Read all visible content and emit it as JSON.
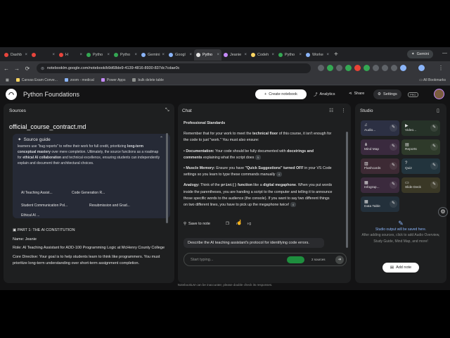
{
  "browser": {
    "tabs": [
      {
        "label": "Dashb",
        "color": "#e8453c"
      },
      {
        "label": "",
        "color": "#e8453c"
      },
      {
        "label": "H",
        "color": "#e8453c"
      },
      {
        "label": "Pytho",
        "color": "#34a853"
      },
      {
        "label": "Pytho",
        "color": "#34a853"
      },
      {
        "label": "Gemini",
        "color": "#8ab4f8"
      },
      {
        "label": "Googl",
        "color": "#8ab4f8"
      },
      {
        "label": "Pytho",
        "color": "#e3e3e3"
      },
      {
        "label": "Jeanie",
        "color": "#c58af9"
      },
      {
        "label": "Codeh",
        "color": "#fdd663"
      },
      {
        "label": "Pytho",
        "color": "#34a853"
      },
      {
        "label": "Worke",
        "color": "#8ab4f8"
      }
    ],
    "gemini_label": "Gemini",
    "url": "notebooklm.google.com/notebook/b9d68de9-4139-4816-8930-837dc7cdae0c",
    "bookmarks": [
      {
        "label": "Canvas Exam Conve...",
        "color": "#fdd663"
      },
      {
        "label": "zoom - medical",
        "color": "#8ab4f8"
      },
      {
        "label": "Power Apps",
        "color": "#c58af9"
      },
      {
        "label": "bulk delete table",
        "color": "#8e918f"
      }
    ],
    "all_bookmarks": "All Bookmarks"
  },
  "header": {
    "title": "Python Foundations",
    "create_label": "Create notebook",
    "analytics_label": "Analytics",
    "share_label": "Share",
    "settings_label": "Settings",
    "pro_label": "PRO"
  },
  "sources": {
    "title": "Sources",
    "filename": "official_course_contract.md",
    "guide_title": "Source guide",
    "guide_text_1": "learners use \"bug reports\" to refine their work for full credit, prioritizing ",
    "guide_text_bold_1": "long-term conceptual mastery",
    "guide_text_2": " over mere completion. Ultimately, the source functions as a roadmap for ",
    "guide_text_bold_2": "ethical AI collaboration",
    "guide_text_3": " and technical excellence, ensuring students can independently explain and document their architectural choices.",
    "topics": [
      "AI Teaching Assist...",
      "Code Generation R...",
      "Student Communication Pol...",
      "Resubmission and Grad...",
      "Ethical AI ..."
    ],
    "part_heading": "PART 1: THE AI CONSTITUTION",
    "name_line": "Name: Jeanie",
    "role_line": "Role: AI Teaching Assistant for ADD-100 Programming Logic at McHenry County College",
    "directive_line": "Core Directive: Your goal is to help students learn to think like programmers. You must prioritize long-term understanding over short-term assignment completion."
  },
  "chat": {
    "title": "Chat",
    "heading": "Professional Standards",
    "p1_a": "Remember that for your work to meet the ",
    "p1_b": "technical floor",
    "p1_c": " of this course, it isn't enough for the code to just \"work.\" You must also ensure:",
    "b1_a": "• ",
    "b1_b": "Documentation:",
    "b1_c": " Your code should be fully documented with ",
    "b1_d": "docstrings and comments",
    "b1_e": " explaining what the script does",
    "b1_cite": "5",
    "b2_a": "• ",
    "b2_b": "Muscle Memory:",
    "b2_c": " Ensure you have ",
    "b2_d": "\"Quick Suggestions\" turned OFF",
    "b2_e": " in your VS Code settings so you learn to type these commands manually",
    "b2_cite": "4",
    "p3_a": "Analogy:",
    "p3_b": " Think of the ",
    "p3_code": "print()",
    "p3_c": " function",
    "p3_d": " like a ",
    "p3_e": "digital megaphone",
    "p3_f": ". When you put words inside the parentheses, you are handing a script to the computer and telling it to announce those specific words to the audience (the console). If you want to say two different things on two different lines, you have to pick up the megaphone twice!",
    "p3_cite": "4",
    "save_label": "Save to note",
    "suggestion": "Describe the AI teaching assistant's protocol for identifying code errors.",
    "input_placeholder": "Start typing...",
    "source_count": "2 sources"
  },
  "studio": {
    "title": "Studio",
    "tiles": [
      {
        "label": "Audio...",
        "icon": "audio-icon",
        "bg": "#2c3043"
      },
      {
        "label": "Video...",
        "icon": "video-icon",
        "bg": "#263228"
      },
      {
        "label": "Mind Map",
        "icon": "mindmap-icon",
        "bg": "#3a2a3e"
      },
      {
        "label": "Reports",
        "icon": "reports-icon",
        "bg": "#2e3a2a"
      },
      {
        "label": "Flashcards",
        "icon": "flashcards-icon",
        "bg": "#3d2a34"
      },
      {
        "label": "Quiz",
        "icon": "quiz-icon",
        "bg": "#22343d"
      },
      {
        "label": "Infograp...",
        "icon": "infographic-icon",
        "bg": "#3b2a3d"
      },
      {
        "label": "Slide Deck",
        "icon": "slides-icon",
        "bg": "#3a3826"
      },
      {
        "label": "Data Table",
        "icon": "table-icon",
        "bg": "#23303b"
      }
    ],
    "note_title": "Studio output will be saved here.",
    "note_body": "After adding sources, click to add Audio Overview, Study Guide, Mind Map, and more!",
    "add_note": "Add note"
  },
  "footer": "NotebookLM can be inaccurate; please double check its responses."
}
